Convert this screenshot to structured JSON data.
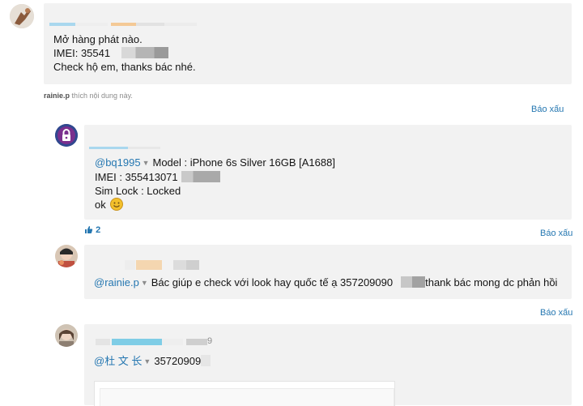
{
  "post1": {
    "lines": [
      "Mở hàng phát nào.",
      "IMEI: 35541",
      "Check hộ em, thanks bác nhé."
    ],
    "like_user": "rainie.p",
    "like_suffix": " thích nội dung này."
  },
  "reply1": {
    "mention": "@bq1995",
    "model_line": "Model : iPhone 6s Silver 16GB [A1688]",
    "imei_line": "IMEI : 355413071",
    "simlock_line": "Sim Lock : Locked",
    "ok_line": "ok",
    "like_count": "2"
  },
  "reply2": {
    "mention": "@rainie.p",
    "message": "Bác giúp e check với look hay quốc tế ạ 357209090",
    "message_end": "thank bác mong dc phản hồi"
  },
  "reply3": {
    "mention": "@杜 文 长",
    "message": "35720909",
    "name_suffix": "9"
  },
  "report_label": "Báo xấu",
  "colors": {
    "accent": "#2577b1",
    "bubble": "#f2f2f2",
    "emoji": "#f3c02b"
  }
}
